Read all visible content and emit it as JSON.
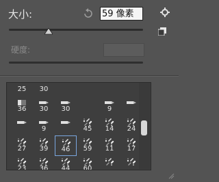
{
  "brush_panel": {
    "size_label": "大小:",
    "size_value": "59 像素",
    "hardness_label": "硬度:",
    "slider_value_percent": 30
  },
  "brush_grid": {
    "selected_index": 20,
    "rows": [
      [
        {
          "num": "25",
          "mark": "dot"
        },
        {
          "num": "30",
          "mark": "dot"
        },
        {
          "num": "",
          "mark": "none"
        },
        {
          "num": "",
          "mark": "none"
        },
        {
          "num": "",
          "mark": "none"
        },
        {
          "num": "",
          "mark": "none"
        }
      ],
      [
        {
          "num": "36",
          "mark": "square"
        },
        {
          "num": "30",
          "mark": "brush"
        },
        {
          "num": "30",
          "mark": "brush"
        },
        {
          "num": "",
          "mark": "none"
        },
        {
          "num": "9",
          "mark": "brush"
        },
        {
          "num": "",
          "mark": "brush"
        }
      ],
      [
        {
          "num": "",
          "mark": "brush"
        },
        {
          "num": "9",
          "mark": "brush"
        },
        {
          "num": "",
          "mark": "brush"
        },
        {
          "num": "45",
          "mark": "spray"
        },
        {
          "num": "14",
          "mark": "spray"
        },
        {
          "num": "24",
          "mark": "spray"
        }
      ],
      [
        {
          "num": "27",
          "mark": "spray"
        },
        {
          "num": "39",
          "mark": "spray"
        },
        {
          "num": "46",
          "mark": "spray"
        },
        {
          "num": "59",
          "mark": "spray"
        },
        {
          "num": "11",
          "mark": "spray"
        },
        {
          "num": "17",
          "mark": "spray"
        }
      ],
      [
        {
          "num": "23",
          "mark": "spray"
        },
        {
          "num": "36",
          "mark": "spray"
        },
        {
          "num": "44",
          "mark": "spray"
        },
        {
          "num": "60",
          "mark": "spray"
        },
        {
          "num": "",
          "mark": "spray"
        },
        {
          "num": "",
          "mark": "spray"
        }
      ]
    ]
  }
}
